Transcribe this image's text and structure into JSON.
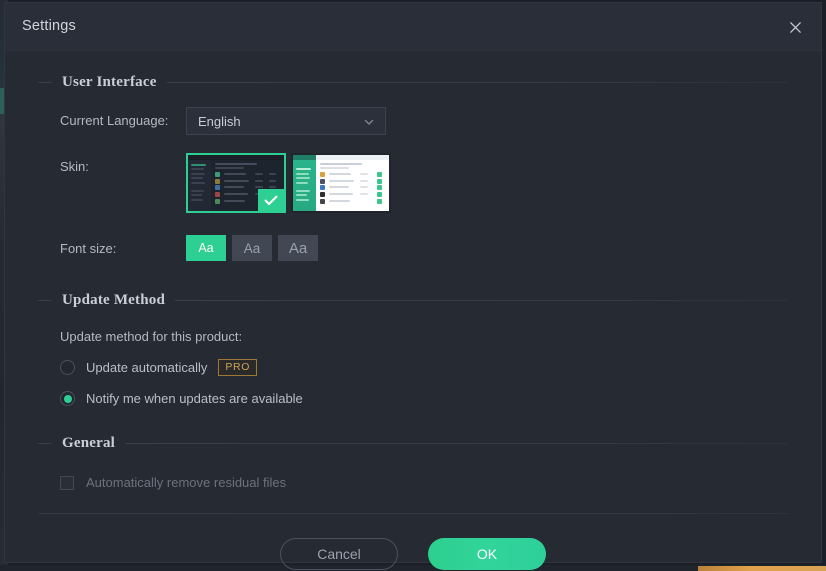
{
  "window": {
    "title": "Settings",
    "close_icon": "close-icon"
  },
  "sections": {
    "user_interface": {
      "title": "User Interface",
      "language": {
        "label": "Current Language:",
        "value": "English",
        "chevron_icon": "chevron-down-icon"
      },
      "skin": {
        "label": "Skin:",
        "options": [
          {
            "name": "dark-skin",
            "selected": true,
            "check_icon": "check-icon"
          },
          {
            "name": "light-skin",
            "selected": false
          }
        ]
      },
      "font_size": {
        "label": "Font size:",
        "options": [
          {
            "label": "Aa",
            "size": "small",
            "selected": true
          },
          {
            "label": "Aa",
            "size": "medium",
            "selected": false
          },
          {
            "label": "Aa",
            "size": "large",
            "selected": false
          }
        ]
      }
    },
    "update_method": {
      "title": "Update Method",
      "description": "Update method for this product:",
      "options": [
        {
          "label": "Update automatically",
          "selected": false,
          "badge": "PRO"
        },
        {
          "label": "Notify me when updates are available",
          "selected": true,
          "badge": ""
        }
      ]
    },
    "general": {
      "title": "General",
      "options": [
        {
          "label": "Automatically remove residual files",
          "checked": false,
          "disabled": true
        }
      ]
    }
  },
  "footer": {
    "cancel_label": "Cancel",
    "ok_label": "OK"
  },
  "colors": {
    "accent": "#2ecf92",
    "dialog_bg": "#262a33",
    "titlebar_bg": "#2a2e38",
    "pro_border": "#9d7838",
    "pro_text": "#cda25a"
  }
}
